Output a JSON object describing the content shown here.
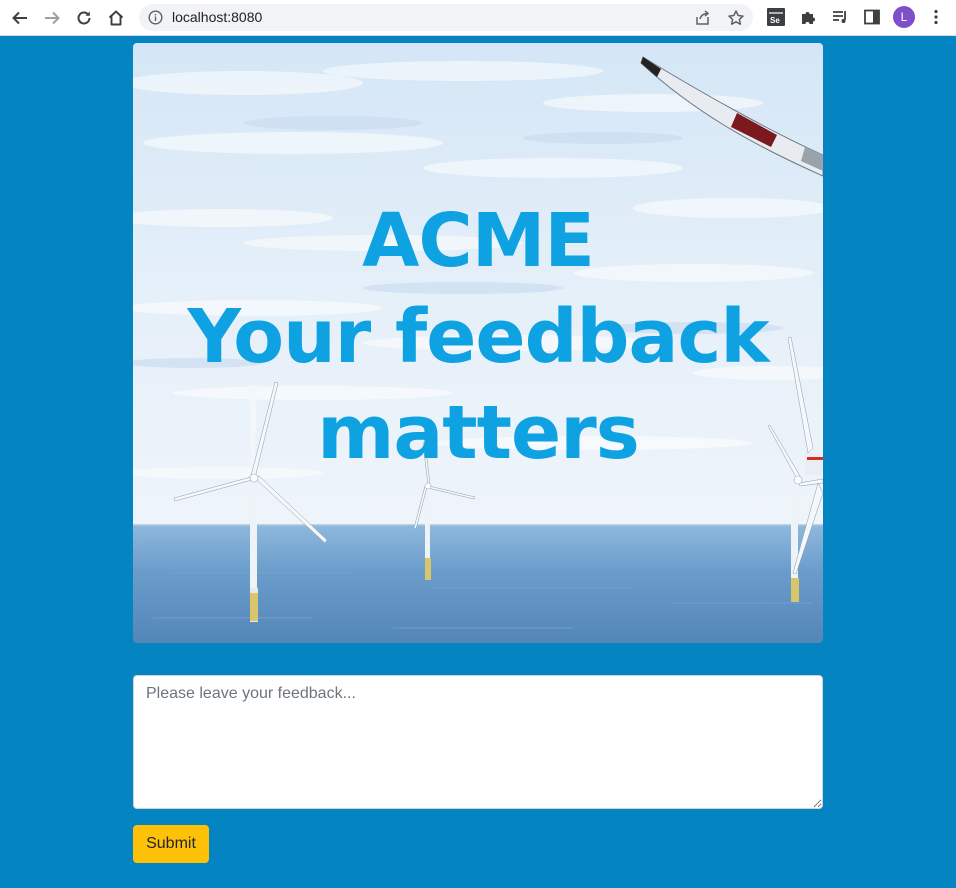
{
  "browser": {
    "url": "localhost:8080",
    "avatar_initial": "L",
    "icons": [
      "back-icon",
      "forward-icon",
      "reload-icon",
      "home-icon",
      "site-info-icon",
      "share-icon",
      "bookmark-star-icon",
      "selenium-extension-icon",
      "extensions-puzzle-icon",
      "media-queue-icon",
      "side-panel-icon",
      "menu-kebab-icon"
    ]
  },
  "hero": {
    "line1": "ACME",
    "line2": "Your feedback",
    "line3": "matters"
  },
  "form": {
    "feedback_placeholder": "Please leave your feedback...",
    "submit_label": "Submit"
  },
  "colors": {
    "page_background": "#0484c0",
    "hero_text": "#0ea2e2",
    "submit_button": "#ffc107",
    "avatar": "#7d4fc9"
  }
}
